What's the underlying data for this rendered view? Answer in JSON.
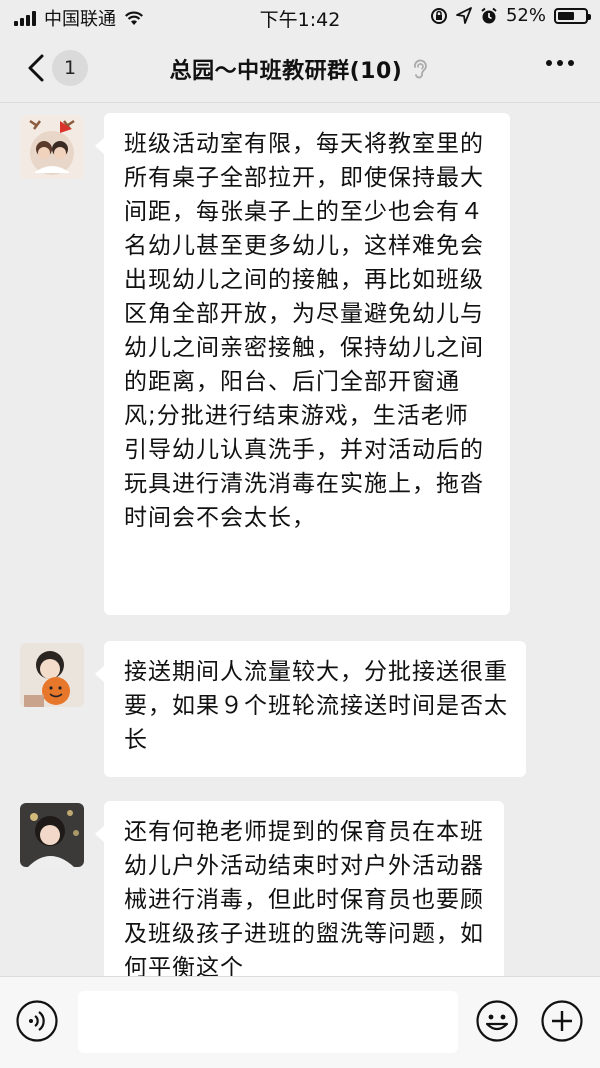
{
  "status_bar": {
    "carrier": "中国联通",
    "time": "下午1:42",
    "battery_text": "52%",
    "battery_level": 0.52
  },
  "nav": {
    "back_count": "1",
    "title": "总园～中班教研群(10)"
  },
  "messages": [
    {
      "text": "班级活动室有限，每天将教室里的所有桌子全部拉开，即使保持最大间距，每张桌子上的至少也会有４名幼儿甚至更多幼儿，这样难免会出现幼儿之间的接触，再比如班级区角全部开放，为尽量避免幼儿与幼儿之间亲密接触，保持幼儿之间的距离，阳台、后门全部开窗通风;分批进行结束游戏，生活老师引导幼儿认真洗手，并对活动后的玩具进行清洗消毒在实施上，拖沓时间会不会太长，"
    },
    {
      "text": "接送期间人流量较大，分批接送很重要，如果９个班轮流接送时间是否太长"
    },
    {
      "text": "还有何艳老师提到的保育员在本班幼儿户外活动结束时对户外活动器械进行消毒，但此时保育员也要顾及班级孩子进班的盥洗等问题，如何平衡这个"
    }
  ],
  "icons": {
    "back": "chevron-left-icon",
    "mute": "ear-icon",
    "more": "more-icon",
    "voice": "voice-icon",
    "emoji": "emoji-icon",
    "plus": "plus-icon"
  }
}
